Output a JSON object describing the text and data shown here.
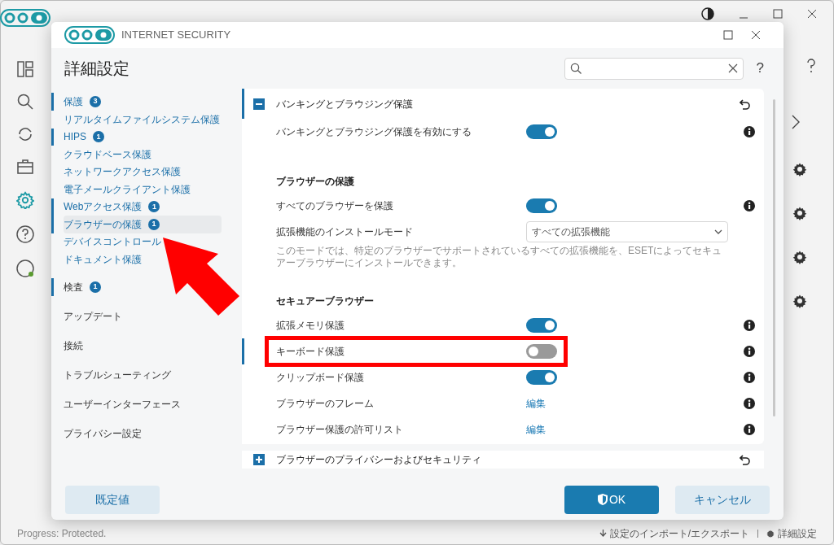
{
  "background": {
    "status": "Progress: Protected.",
    "links": [
      "設定のインポート/エクスポート",
      "詳細設定"
    ]
  },
  "dialog": {
    "brand": "INTERNET SECURITY",
    "title": "詳細設定",
    "help": "?"
  },
  "nav": [
    {
      "label": "保護",
      "badge": "3",
      "expanded": true,
      "children": [
        {
          "label": "リアルタイムファイルシステム保護",
          "selected": false
        },
        {
          "label": "HIPS",
          "badge": "1",
          "selected": false
        },
        {
          "label": "クラウドベース保護",
          "selected": false
        },
        {
          "label": "ネットワークアクセス保護",
          "selected": false
        },
        {
          "label": "電子メールクライアント保護",
          "selected": false
        },
        {
          "label": "Webアクセス保護",
          "badge": "1",
          "selected": false
        },
        {
          "label": "ブラウザーの保護",
          "badge": "1",
          "selected": true
        },
        {
          "label": "デバイスコントロール",
          "selected": false
        },
        {
          "label": "ドキュメント保護",
          "selected": false
        }
      ]
    },
    {
      "label": "検査",
      "badge": "1",
      "expanded": false
    },
    {
      "label": "アップデート",
      "expanded": false
    },
    {
      "label": "接続",
      "expanded": false
    },
    {
      "label": "トラブルシューティング",
      "expanded": false
    },
    {
      "label": "ユーザーインターフェース",
      "expanded": false
    },
    {
      "label": "プライバシー設定",
      "expanded": false
    }
  ],
  "section": {
    "title": "バンキングとブラウジング保護",
    "expanded": true,
    "rows": [
      {
        "kind": "toggle",
        "label": "バンキングとブラウジング保護を有効にする",
        "on": true,
        "changed": false
      },
      {
        "kind": "heading",
        "label": "ブラウザーの保護"
      },
      {
        "kind": "toggle",
        "label": "すべてのブラウザーを保護",
        "on": true,
        "changed": false
      },
      {
        "kind": "select",
        "label": "拡張機能のインストールモード",
        "value": "すべての拡張機能",
        "changed": false
      },
      {
        "kind": "note",
        "label": "このモードでは、特定のブラウザーでサポートされているすべての拡張機能を、ESETによってセキュアーブラウザーにインストールできます。"
      },
      {
        "kind": "heading",
        "label": "セキュアーブラウザー"
      },
      {
        "kind": "toggle",
        "label": "拡張メモリ保護",
        "on": true,
        "changed": false
      },
      {
        "kind": "toggle",
        "label": "キーボード保護",
        "on": false,
        "changed": true,
        "highlighted": true
      },
      {
        "kind": "toggle",
        "label": "クリップボード保護",
        "on": true,
        "changed": false
      },
      {
        "kind": "link",
        "label": "ブラウザーのフレーム",
        "value": "編集",
        "changed": false
      },
      {
        "kind": "link",
        "label": "ブラウザー保護の許可リスト",
        "value": "編集",
        "changed": false
      }
    ]
  },
  "next_section": {
    "title": "ブラウザーのプライバシーおよびセキュリティ",
    "expanded": false
  },
  "buttons": [
    {
      "label": "既定値",
      "kind": "secondary"
    },
    {
      "label": "OK",
      "kind": "primary"
    },
    {
      "label": "キャンセル",
      "kind": "secondary"
    }
  ]
}
